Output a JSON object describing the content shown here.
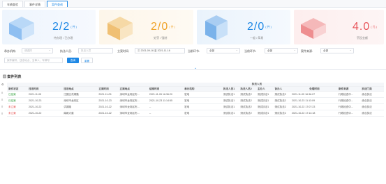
{
  "tabs": [
    {
      "label": "车辆查验"
    },
    {
      "label": "事件详情"
    },
    {
      "label": "案件查询"
    }
  ],
  "cards": [
    {
      "value": "2/2",
      "unit": "(件)",
      "caption": "待办理 / 已办理",
      "color": "#1e88e5"
    },
    {
      "value": "2/0",
      "unit": "(件)",
      "caption": "处罚 / 强制",
      "color": "#f0a32a"
    },
    {
      "value": "2/0",
      "unit": "(件)",
      "caption": "一般 / 简易",
      "color": "#1e88e5"
    },
    {
      "value": "4.0",
      "unit": "(元)",
      "caption": "罚没金额",
      "color": "#e8545a"
    }
  ],
  "filters": {
    "org_label": "承办机构:",
    "org_placeholder": "请选择",
    "officer_label": "执法人员:",
    "officer_placeholder": "执法人员",
    "time_label": "立案时间:",
    "time_start": "2021-09-16",
    "time_sep": "至",
    "time_end": "2021-11-16",
    "stage_label": "当前环节:",
    "stage_value": "全部",
    "appr_label": "当前环节:",
    "appr_value": "全部",
    "source_label": "案件来源:",
    "source_value": "全部",
    "keyword_placeholder": "案件编号、违法地点、当事人、车牌号",
    "search_label": "查询",
    "reset_label": "重置"
  },
  "section_title": "案件列表",
  "table": {
    "headers": [
      "案件状态",
      "违法时间",
      "违法地点",
      "立案时间",
      "立案地点",
      "结案时间",
      "承办机构",
      "执法人员1",
      "执法人员2",
      "主办人",
      "协办人",
      "处理时间",
      "案件来源",
      "执法门类"
    ],
    "group_header": "执法人员",
    "rows": [
      {
        "status": "已结案",
        "status_class": "st-g",
        "cells": [
          "2021-11-05",
          "江夏区洪湖路",
          "2021-11-05",
          "深圳市龙岗区布…",
          "2021-11-05 16:36:20",
          "宏电",
          "测试执法1",
          "测试执法2",
          "测试执法1",
          "测试执法2",
          "2021-11-05 16:36:07",
          "行政检查中…",
          "综合执法"
        ]
      },
      {
        "status": "已结案",
        "status_class": "st-g",
        "cells": [
          "2021-10-23",
          "深圳市龙岗区",
          "2021-10-23",
          "深圳市龙岗区布…",
          "2021-10-23 11:14:55",
          "宏电",
          "测试执法1",
          "测试执法2",
          "测试执法1",
          "测试执法2",
          "2021-10-23 11:13:09",
          "行政检查中…",
          "综合执法"
        ]
      },
      {
        "status": "未立案",
        "status_class": "st-r",
        "cells": [
          "2021-10-22",
          "洪湖路",
          "2021-10-22",
          "深圳市龙岗区布…",
          "--",
          "宏电",
          "测试执法1",
          "测试执法2",
          "测试执法1",
          "测试执法2",
          "2021-10-22 17:07:23",
          "行政检查中…",
          "综合执法"
        ]
      },
      {
        "status": "未立案",
        "status_class": "st-r",
        "cells": [
          "2021-10-22",
          "南城大道",
          "2021-10-22",
          "深圳市龙岗区布…",
          "--",
          "宏电",
          "测试执法1",
          "测试执法2",
          "测试执法1",
          "测试执法2",
          "2021-10-22 17:14:18",
          "行政检查中…",
          "综合执法"
        ]
      }
    ]
  }
}
